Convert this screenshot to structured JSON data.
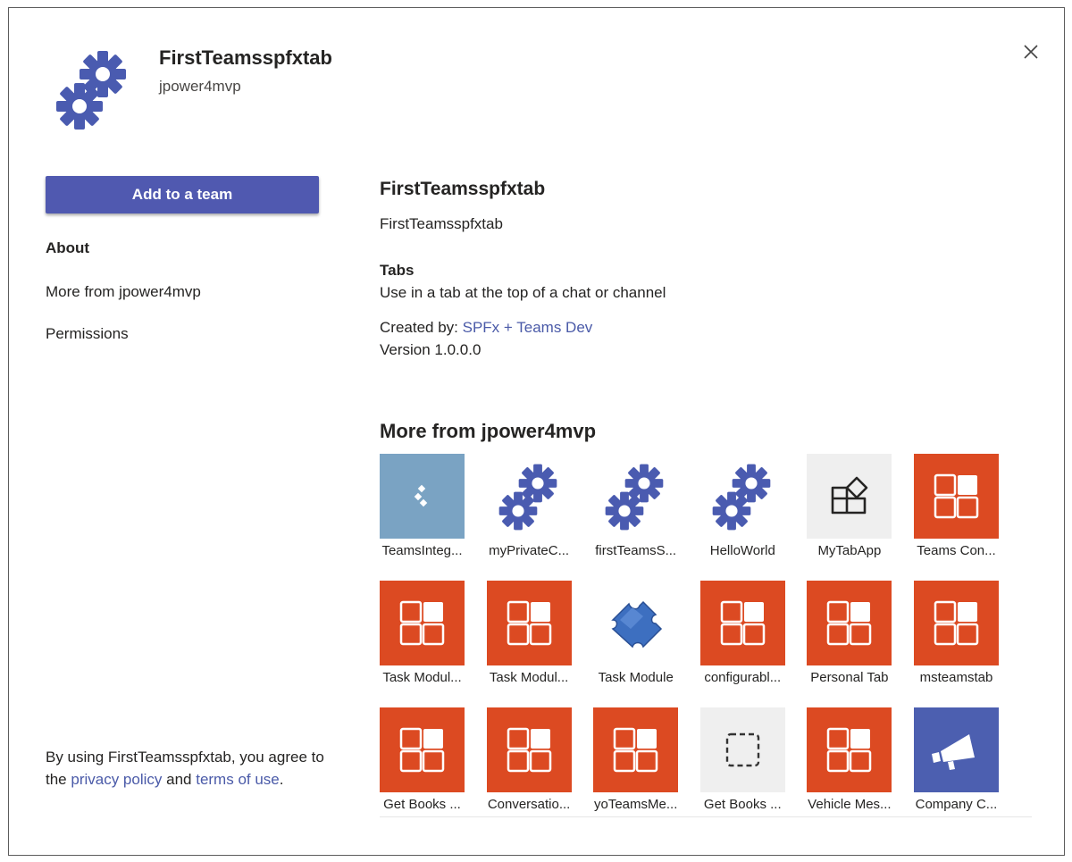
{
  "app": {
    "name": "FirstTeamsspfxtab",
    "publisher": "jpower4mvp",
    "icon": "gears-icon"
  },
  "close": {
    "icon": "close-icon"
  },
  "sidebar": {
    "add_button_label": "Add to a team",
    "nav": [
      {
        "label": "About",
        "active": true
      },
      {
        "label": "More from jpower4mvp",
        "active": false
      },
      {
        "label": "Permissions",
        "active": false
      }
    ],
    "footer": {
      "prefix": "By using FirstTeamsspfxtab, you agree to the ",
      "privacy_link": "privacy policy",
      "and_text": " and ",
      "terms_link": "terms of use",
      "suffix": "."
    }
  },
  "details": {
    "title": "FirstTeamsspfxtab",
    "description": "FirstTeamsspfxtab",
    "capability_title": "Tabs",
    "capability_desc": "Use in a tab at the top of a chat or channel",
    "created_by_label": "Created by:",
    "created_by_link": "SPFx + Teams Dev",
    "version": "Version 1.0.0.0"
  },
  "more": {
    "title": "More from jpower4mvp",
    "apps": [
      {
        "label": "TeamsInteg...",
        "icon": "teams-diamond-icon"
      },
      {
        "label": "myPrivateC...",
        "icon": "gears-icon"
      },
      {
        "label": "firstTeamsS...",
        "icon": "gears-icon"
      },
      {
        "label": "HelloWorld",
        "icon": "gears-icon"
      },
      {
        "label": "MyTabApp",
        "icon": "app-grid-icon"
      },
      {
        "label": "Teams Con...",
        "icon": "orange-tiles-icon"
      },
      {
        "label": "Task Modul...",
        "icon": "orange-tiles-icon"
      },
      {
        "label": "Task Modul...",
        "icon": "orange-tiles-icon"
      },
      {
        "label": "Task Module",
        "icon": "puzzle-icon"
      },
      {
        "label": "configurabl...",
        "icon": "orange-tiles-icon"
      },
      {
        "label": "Personal Tab",
        "icon": "orange-tiles-icon"
      },
      {
        "label": "msteamstab",
        "icon": "orange-tiles-icon"
      },
      {
        "label": "Get Books ...",
        "icon": "orange-tiles-icon"
      },
      {
        "label": "Conversatio...",
        "icon": "orange-tiles-icon"
      },
      {
        "label": "yoTeamsMe...",
        "icon": "orange-tiles-icon"
      },
      {
        "label": "Get Books ...",
        "icon": "dashed-square-icon"
      },
      {
        "label": "Vehicle Mes...",
        "icon": "orange-tiles-icon"
      },
      {
        "label": "Company C...",
        "icon": "megaphone-icon"
      }
    ]
  },
  "colors": {
    "accent": "#5059b0",
    "link": "#4a5aa8",
    "gear": "#4a5bb0",
    "orange_tile": "#dc4a22",
    "teams_blue_tile": "#7aa3c3",
    "gray_tile": "#efefef",
    "megaphone_tile": "#4c5fb0"
  }
}
